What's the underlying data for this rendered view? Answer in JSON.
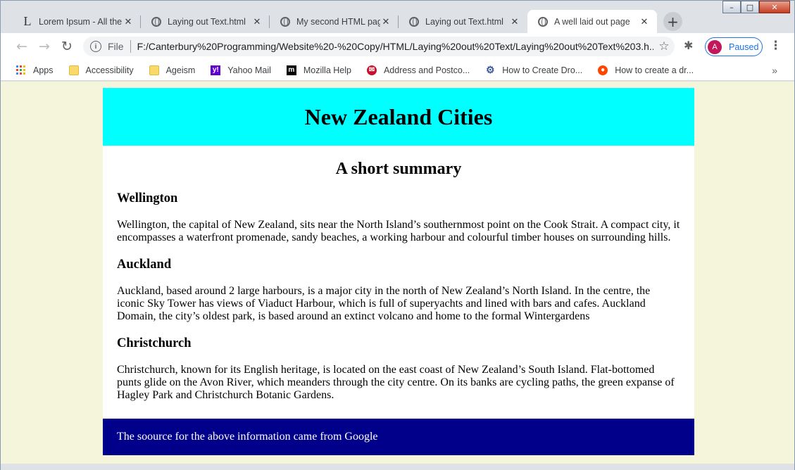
{
  "window": {
    "controls": {
      "minimize": "–",
      "maximize": "□",
      "close": "✕"
    }
  },
  "tabs": [
    {
      "title": "Lorem Ipsum - All the",
      "icon": "lorem-ipsum-icon",
      "active": false
    },
    {
      "title": "Laying out Text.html",
      "icon": "globe-icon",
      "active": false
    },
    {
      "title": "My second HTML page",
      "icon": "globe-icon",
      "active": false
    },
    {
      "title": "Laying out Text.html",
      "icon": "globe-icon",
      "active": false
    },
    {
      "title": "A well laid out page",
      "icon": "globe-icon",
      "active": true
    }
  ],
  "toolbar": {
    "omnibox_label": "File",
    "url": "F:/Canterbury%20Programming/Website%20-%20Copy/HTML/Laying%20out%20Text/Laying%20out%20Text%203.h...",
    "profile_initial": "A",
    "profile_status": "Paused"
  },
  "bookmarks": [
    {
      "label": "Apps",
      "icon": "apps-grid-icon"
    },
    {
      "label": "Accessibility",
      "icon": "folder-icon"
    },
    {
      "label": "Ageism",
      "icon": "folder-icon"
    },
    {
      "label": "Yahoo Mail",
      "icon": "yahoo-icon"
    },
    {
      "label": "Mozilla Help",
      "icon": "mozilla-icon"
    },
    {
      "label": "Address and Postco...",
      "icon": "mail-icon"
    },
    {
      "label": "How to Create Dro...",
      "icon": "gear-icon"
    },
    {
      "label": "How to create a dr...",
      "icon": "reddit-icon"
    }
  ],
  "page": {
    "header_title": "New Zealand Cities",
    "summary_heading": "A short summary",
    "sections": [
      {
        "heading": "Wellington",
        "text": "Wellington, the capital of New Zealand, sits near the North Island’s southernmost point on the Cook Strait. A compact city, it encompasses a waterfront promenade, sandy beaches, a working harbour and colourful timber houses on surrounding hills."
      },
      {
        "heading": "Auckland",
        "text": "Auckland, based around 2 large harbours, is a major city in the north of New Zealand’s North Island. In the centre, the iconic Sky Tower has views of Viaduct Harbour, which is full of superyachts and lined with bars and cafes. Auckland Domain, the city’s oldest park, is based around an extinct volcano and home to the formal Wintergardens"
      },
      {
        "heading": "Christchurch",
        "text": "Christchurch, known for its English heritage, is located on the east coast of New Zealand’s South Island. Flat-bottomed punts glide on the Avon River, which meanders through the city centre. On its banks are cycling paths, the green expanse of Hagley Park and Christchurch Botanic Gardens."
      }
    ],
    "footer_text": "The soource for the above information came from Google"
  },
  "colors": {
    "page_background": "#f5f5dc",
    "header_background": "#00ffff",
    "footer_background": "#00008b",
    "footer_text": "#ffffff"
  }
}
